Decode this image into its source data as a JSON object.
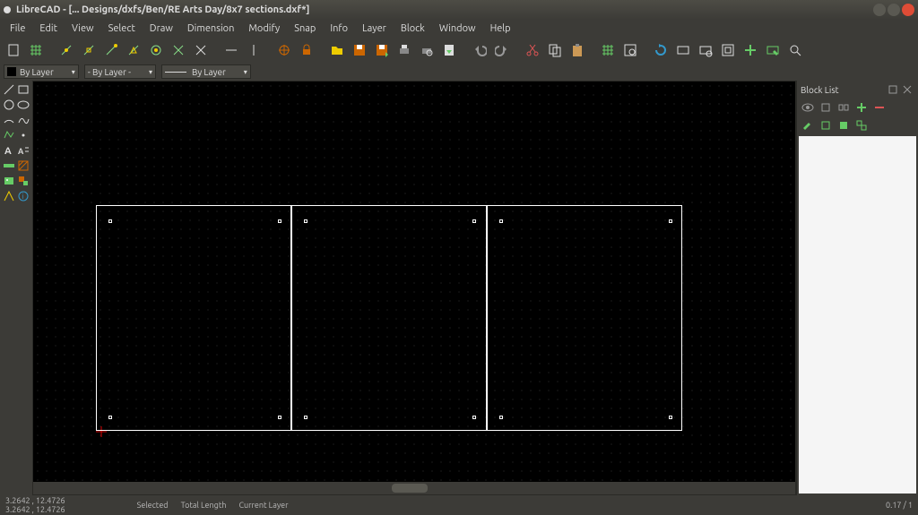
{
  "title": "LibreCAD - [... Designs/dxfs/Ben/RE Arts Day/8x7 sections.dxf*]",
  "menu": {
    "file": "File",
    "edit": "Edit",
    "view": "View",
    "select": "Select",
    "draw": "Draw",
    "dimension": "Dimension",
    "modify": "Modify",
    "snap": "Snap",
    "info": "Info",
    "layer": "Layer",
    "block": "Block",
    "window": "Window",
    "help": "Help"
  },
  "props": {
    "color": "By Layer",
    "width": "- By Layer -",
    "line": "By Layer"
  },
  "blocklist": {
    "title": "Block List"
  },
  "status": {
    "coord1": "3.2642 , 12.4726",
    "coord2": "3.2642 , 12.4726",
    "selected": "Selected",
    "totallength": "Total Length",
    "currentlayer": "Current Layer",
    "zoom": "0.17 / 1"
  },
  "icons": {
    "new": "new",
    "grid": "grid",
    "snap_free": "snap-free",
    "snap_grid": "snap-grid",
    "snap_end": "snap-end",
    "snap_mid": "snap-mid",
    "snap_center": "snap-center",
    "snap_int": "snap-int",
    "offset": "offset",
    "restrict_h": "restrict-h",
    "restrict_v": "restrict-v",
    "rel0": "rel-zero",
    "lock_rel": "lock-rel",
    "open": "open",
    "save": "save",
    "saveas": "save-as",
    "print": "print",
    "printprev": "print-preview",
    "import": "import",
    "undo": "undo",
    "redo": "redo",
    "cut": "cut",
    "copy": "copy",
    "paste": "paste",
    "grid2": "grid2",
    "draft": "draft",
    "redraw": "redraw",
    "zoom_prev": "zoom-prev",
    "zoom_win": "zoom-win",
    "zoom_auto": "zoom-auto",
    "zoom_pan": "zoom-pan",
    "zoom_sel": "zoom-sel",
    "close": "close-dock",
    "float": "float-dock",
    "eye": "visible",
    "sel": "select",
    "add": "add",
    "rem": "remove",
    "ren": "rename",
    "arrow": "arrow"
  }
}
